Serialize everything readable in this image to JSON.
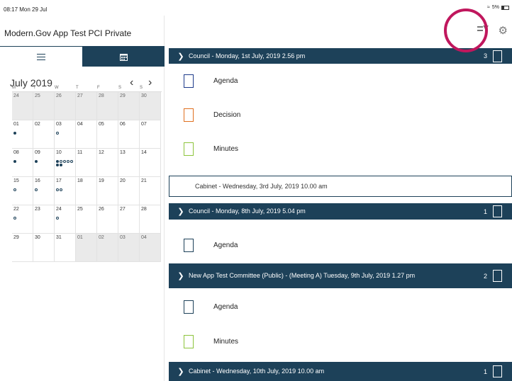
{
  "status": {
    "time": "08:17  Mon 29 Jul",
    "battery": "5%"
  },
  "app": {
    "title": "Modern.Gov App Test PCI Private"
  },
  "calendar": {
    "month": "July 2019",
    "dow": [
      "M",
      "T",
      "W",
      "T",
      "F",
      "S",
      "S"
    ],
    "weeks": [
      [
        "24",
        "25",
        "26",
        "27",
        "28",
        "29",
        "30"
      ],
      [
        "01",
        "02",
        "03",
        "04",
        "05",
        "06",
        "07"
      ],
      [
        "08",
        "09",
        "10",
        "11",
        "12",
        "13",
        "14"
      ],
      [
        "15",
        "16",
        "17",
        "18",
        "19",
        "20",
        "21"
      ],
      [
        "22",
        "23",
        "24",
        "25",
        "26",
        "27",
        "28"
      ],
      [
        "29",
        "30",
        "31",
        "01",
        "02",
        "03",
        "04"
      ]
    ]
  },
  "meetings": [
    {
      "title": "Council - Monday, 1st July, 2019 2.56 pm",
      "count": "3"
    },
    {
      "title": "Cabinet - Wednesday, 3rd July, 2019 10.00 am"
    },
    {
      "title": "Council - Monday, 8th July, 2019 5.04 pm",
      "count": "1"
    },
    {
      "title": "New App Test Committee (Public) - (Meeting A) Tuesday, 9th July, 2019 1.27 pm",
      "count": "2"
    },
    {
      "title": "Cabinet - Wednesday, 10th July, 2019 10.00 am",
      "count": "1"
    }
  ],
  "docs": [
    {
      "label": "Agenda",
      "color": "#1d3a8a"
    },
    {
      "label": "Decision",
      "color": "#e07020"
    },
    {
      "label": "Minutes",
      "color": "#8dc43c"
    },
    {
      "label": "Agenda",
      "color": "#1d4159"
    },
    {
      "label": "Agenda",
      "color": "#1d4159"
    },
    {
      "label": "Minutes",
      "color": "#8dc43c"
    }
  ]
}
